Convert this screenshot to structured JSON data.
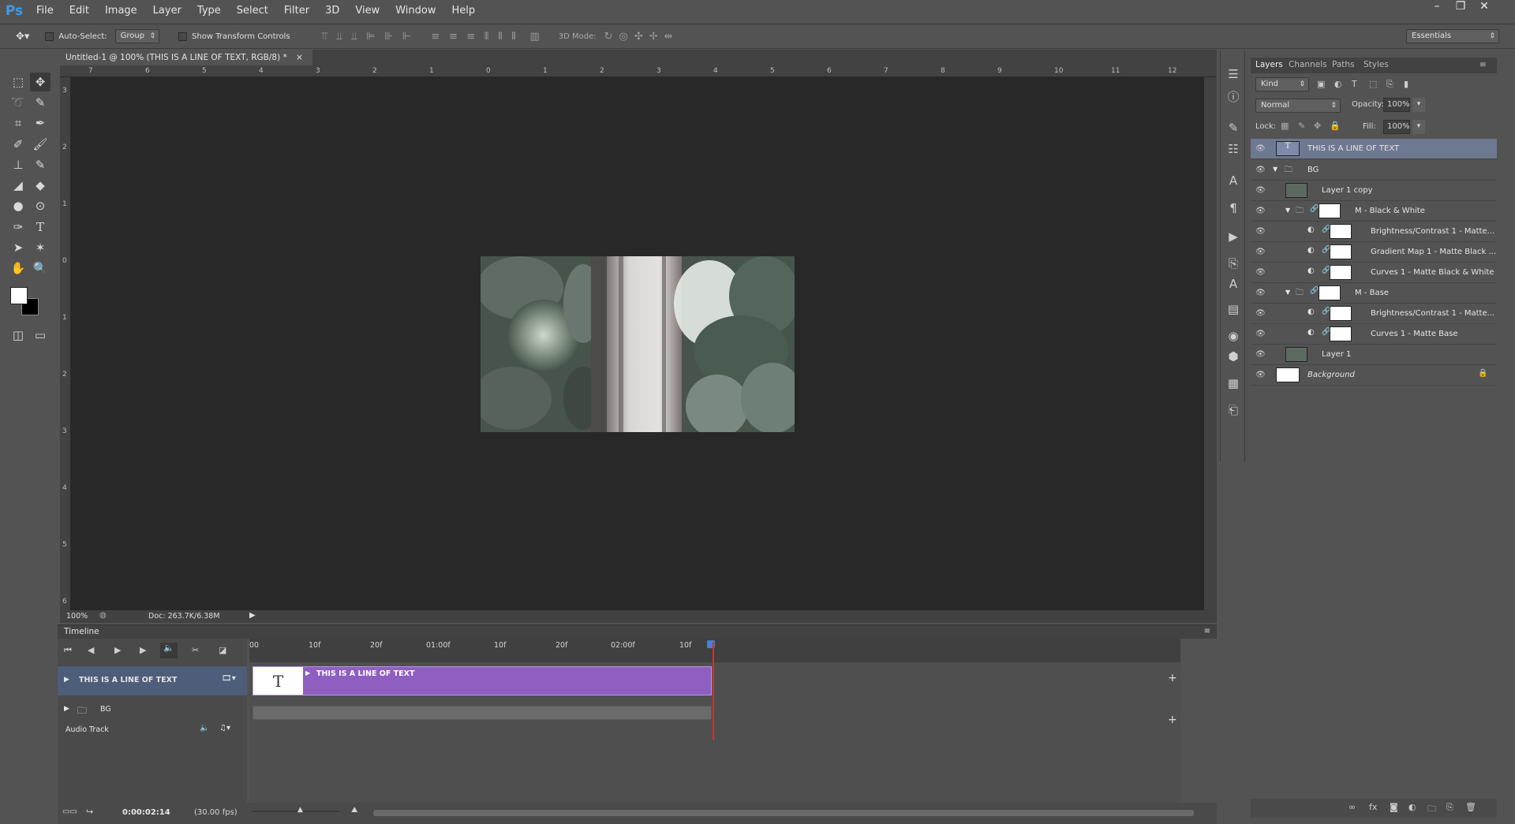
{
  "app": {
    "logo": "Ps"
  },
  "menubar": {
    "items": [
      "File",
      "Edit",
      "Image",
      "Layer",
      "Type",
      "Select",
      "Filter",
      "3D",
      "View",
      "Window",
      "Help"
    ]
  },
  "options": {
    "auto_select_label": "Auto-Select:",
    "auto_select_value": "Group",
    "transform_label": "Show Transform Controls",
    "mode_3d_label": "3D Mode:",
    "workspace": "Essentials"
  },
  "document": {
    "tab_title": "Untitled-1 @ 100% (THIS IS A LINE OF TEXT, RGB/8) *",
    "zoom": "100%",
    "doc_size": "Doc: 263.7K/6.38M",
    "ruler_h": [
      "7",
      "6",
      "5",
      "4",
      "3",
      "2",
      "1",
      "0",
      "1",
      "2",
      "3",
      "4",
      "5",
      "6",
      "7",
      "8",
      "9",
      "10",
      "11",
      "12"
    ],
    "ruler_v": [
      "3",
      "2",
      "1",
      "0",
      "1",
      "2",
      "3",
      "4",
      "5",
      "6"
    ]
  },
  "timeline": {
    "title": "Timeline",
    "ruler": [
      "00",
      "10f",
      "20f",
      "01:00f",
      "10f",
      "20f",
      "02:00f",
      "10f"
    ],
    "tracks": [
      {
        "name": "THIS IS A LINE OF TEXT"
      },
      {
        "name": "BG"
      },
      {
        "name": "Audio Track"
      }
    ],
    "clip_label": "THIS IS A LINE OF TEXT",
    "clip_thumb_glyph": "T",
    "current_time": "0:00:02:14",
    "fps": "(30.00 fps)"
  },
  "layers_panel": {
    "tabs": [
      "Layers",
      "Channels",
      "Paths",
      "Styles"
    ],
    "filter_kind": "Kind",
    "blend_mode": "Normal",
    "opacity_label": "Opacity:",
    "opacity_value": "100%",
    "lock_label": "Lock:",
    "fill_label": "Fill:",
    "fill_value": "100%",
    "layers": [
      {
        "name": "THIS IS A LINE OF TEXT",
        "type": "text"
      },
      {
        "name": "BG",
        "type": "group"
      },
      {
        "name": "Layer 1 copy",
        "type": "image"
      },
      {
        "name": "M - Black & White",
        "type": "group"
      },
      {
        "name": "Brightness/Contrast 1 - Matte...",
        "type": "adjustment"
      },
      {
        "name": "Gradient Map 1 - Matte Black ...",
        "type": "adjustment"
      },
      {
        "name": "Curves 1 - Matte Black & White",
        "type": "adjustment"
      },
      {
        "name": "M - Base",
        "type": "group"
      },
      {
        "name": "Brightness/Contrast 1 - Matte...",
        "type": "adjustment"
      },
      {
        "name": "Curves 1 - Matte Base",
        "type": "adjustment"
      },
      {
        "name": "Layer 1",
        "type": "image"
      },
      {
        "name": "Background",
        "type": "background"
      }
    ]
  },
  "colors": {
    "accent": "#3e9ce8",
    "clip": "#8e5fc0",
    "selected_layer": "#6d7891",
    "playhead": "#c0392b"
  }
}
